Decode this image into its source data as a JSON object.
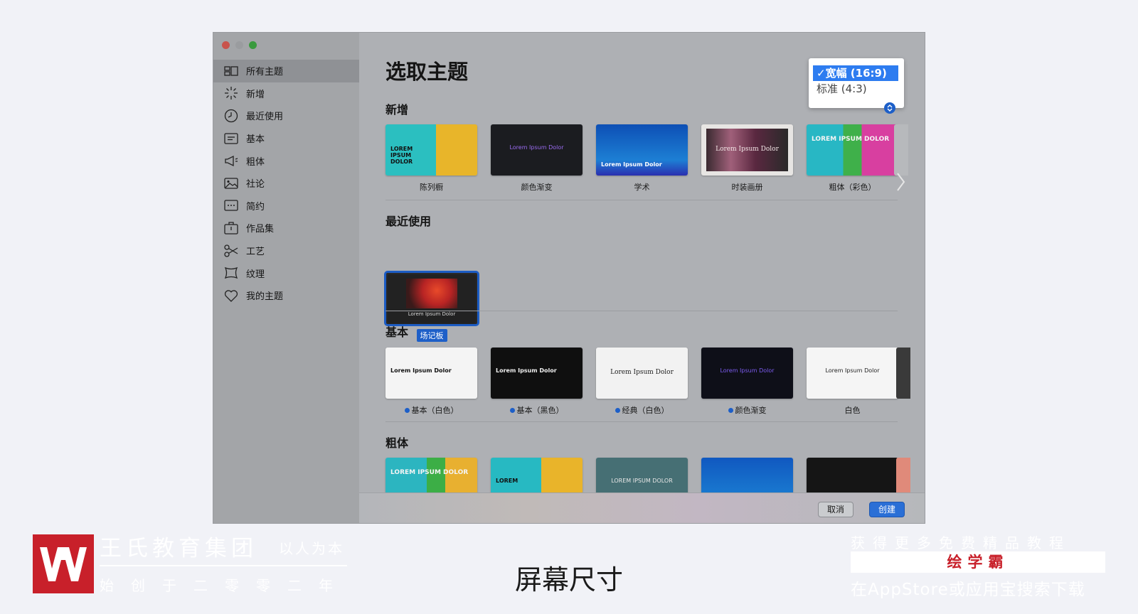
{
  "sidebar": {
    "items": [
      {
        "label": "所有主题",
        "icon": "all-themes-icon"
      },
      {
        "label": "新增",
        "icon": "new-sparkle-icon"
      },
      {
        "label": "最近使用",
        "icon": "clock-icon"
      },
      {
        "label": "基本",
        "icon": "basic-icon"
      },
      {
        "label": "粗体",
        "icon": "megaphone-icon"
      },
      {
        "label": "社论",
        "icon": "image-icon"
      },
      {
        "label": "简约",
        "icon": "ellipsis-icon"
      },
      {
        "label": "作品集",
        "icon": "portfolio-icon"
      },
      {
        "label": "工艺",
        "icon": "scissors-icon"
      },
      {
        "label": "纹理",
        "icon": "texture-icon"
      },
      {
        "label": "我的主题",
        "icon": "heart-icon"
      }
    ]
  },
  "main": {
    "title": "选取主题",
    "sections": {
      "new": {
        "title": "新增",
        "themes": [
          {
            "label": "陈列橱",
            "thumb_text": "LOREM IPSUM DOLOR",
            "bg": "#2bbfc0"
          },
          {
            "label": "颜色渐变",
            "thumb_text": "Lorem Ipsum Dolor",
            "bg": "#1b1c20"
          },
          {
            "label": "学术",
            "thumb_text": "Lorem Ipsum Dolor",
            "bg": "#0d4fb5"
          },
          {
            "label": "时装画册",
            "thumb_text": "Lorem Ipsum Dolor",
            "bg": "#e7e5e3"
          },
          {
            "label": "粗体（彩色）",
            "thumb_text": "LOREM IPSUM DOLOR",
            "bg": "#28b7c4"
          }
        ]
      },
      "recent": {
        "title": "最近使用",
        "themes": [
          {
            "label": "场记板",
            "thumb_text": "Lorem Ipsum Dolor",
            "bg": "#222222"
          }
        ]
      },
      "basic": {
        "title": "基本",
        "themes": [
          {
            "label": "基本（白色）",
            "thumb_text": "Lorem Ipsum Dolor",
            "bg": "#f4f4f4",
            "dot": true
          },
          {
            "label": "基本（黑色）",
            "thumb_text": "Lorem Ipsum Dolor",
            "bg": "#0f0f0f",
            "dot": true
          },
          {
            "label": "经典（白色）",
            "thumb_text": "Lorem Ipsum Dolor",
            "bg": "#f2f2f2",
            "dot": true
          },
          {
            "label": "颜色渐变",
            "thumb_text": "Lorem Ipsum Dolor",
            "bg": "#0e0f18",
            "dot": true
          },
          {
            "label": "白色",
            "thumb_text": "Lorem Ipsum Dolor",
            "bg": "#f5f5f5",
            "dot": false
          }
        ]
      },
      "bold": {
        "title": "粗体",
        "themes": [
          {
            "thumb_text": "LOREM IPSUM DOLOR",
            "bg": "#2cb5c0"
          },
          {
            "thumb_text": "LOREM",
            "bg": "#27b9c2"
          },
          {
            "thumb_text": "LOREM IPSUM DOLOR",
            "bg": "#466f74"
          },
          {
            "thumb_text": "",
            "bg": "#1058c0"
          },
          {
            "thumb_text": "",
            "bg": "#151515"
          }
        ]
      }
    }
  },
  "aspect_popup": {
    "options": [
      {
        "label": "✓宽幅 (16:9)",
        "selected": true
      },
      {
        "label": "标准 (4:3)",
        "selected": false
      }
    ]
  },
  "buttons": {
    "cancel": "取消",
    "create": "创建"
  },
  "branding": {
    "name": "王氏教育集团",
    "tagline": "以人为本",
    "since": "始创于二零零二年"
  },
  "caption": "屏幕尺寸",
  "promo": {
    "line1": "获得更多免费精品教程",
    "band": "绘学霸",
    "line3": "在AppStore或应用宝搜索下载"
  },
  "colors": {
    "accent": "#1d5fc8",
    "brand_red": "#c8202a"
  }
}
